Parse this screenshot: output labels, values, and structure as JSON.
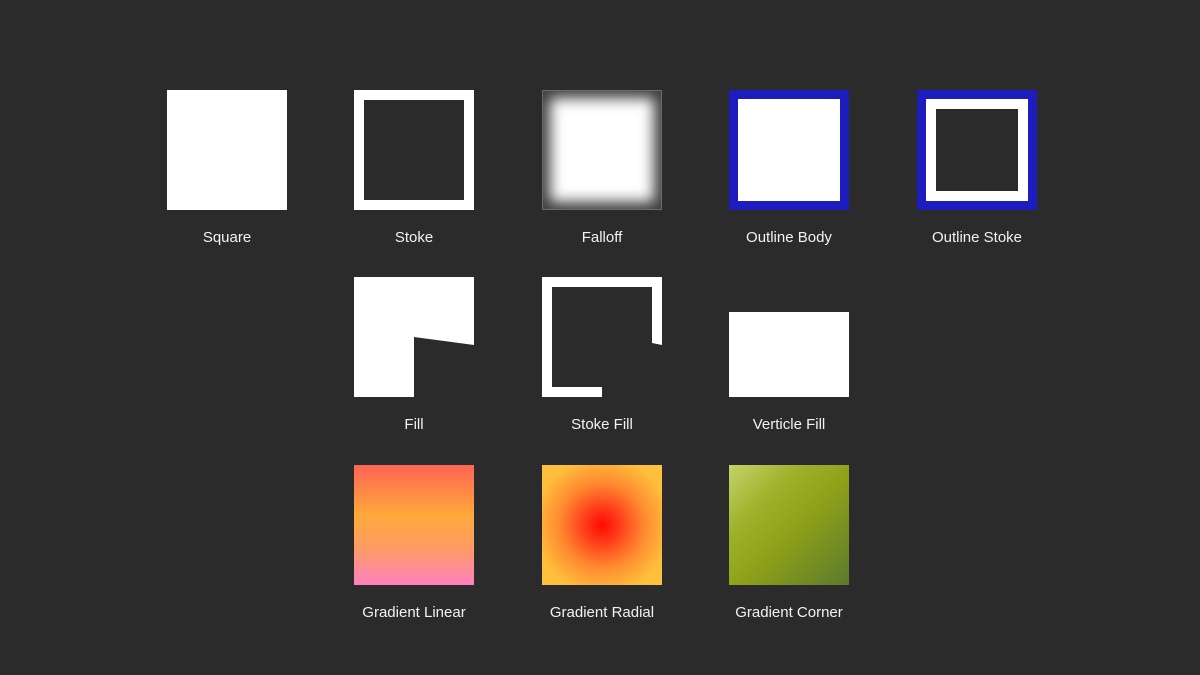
{
  "background_color": "#2b2b2b",
  "accent_colors": {
    "outline_blue": "#1c1cbf",
    "white": "#ffffff"
  },
  "tiles": [
    {
      "id": "square",
      "label": "Square"
    },
    {
      "id": "stoke",
      "label": "Stoke"
    },
    {
      "id": "falloff",
      "label": "Falloff"
    },
    {
      "id": "outline_body",
      "label": "Outline Body"
    },
    {
      "id": "outline_stoke",
      "label": "Outline Stoke"
    },
    {
      "id": "fill",
      "label": "Fill"
    },
    {
      "id": "stoke_fill",
      "label": "Stoke Fill"
    },
    {
      "id": "verticle_fill",
      "label": "Verticle Fill"
    },
    {
      "id": "gradient_linear",
      "label": "Gradient Linear"
    },
    {
      "id": "gradient_radial",
      "label": "Gradient Radial"
    },
    {
      "id": "gradient_corner",
      "label": "Gradient Corner"
    }
  ]
}
